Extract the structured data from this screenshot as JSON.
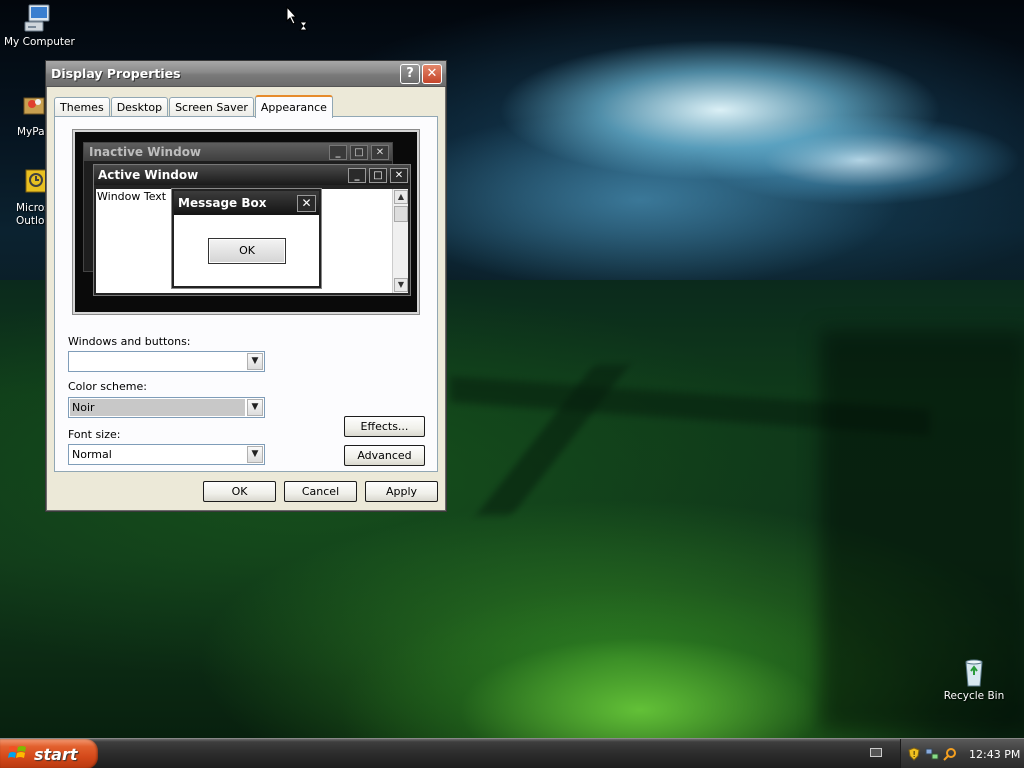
{
  "desktop": {
    "icons": [
      {
        "label": "My Computer"
      },
      {
        "label": "MyPa"
      },
      {
        "label": "Micros\nOutlo"
      },
      {
        "label": "Recycle Bin"
      }
    ]
  },
  "dialog": {
    "title": "Display Properties",
    "help_glyph": "?",
    "close_glyph": "✕",
    "tabs": [
      {
        "label": "Themes"
      },
      {
        "label": "Desktop"
      },
      {
        "label": "Screen Saver"
      },
      {
        "label": "Appearance",
        "active": true
      }
    ],
    "preview": {
      "inactive_title": "Inactive Window",
      "active_title": "Active Window",
      "window_text": "Window Text",
      "message_box_title": "Message Box",
      "message_ok": "OK"
    },
    "windows_buttons": {
      "label": "Windows and buttons:",
      "value": ""
    },
    "color_scheme": {
      "label": "Color scheme:",
      "value": "Noir"
    },
    "font_size": {
      "label": "Font size:",
      "value": "Normal"
    },
    "effects_label": "Effects...",
    "advanced_label": "Advanced",
    "ok_label": "OK",
    "cancel_label": "Cancel",
    "apply_label": "Apply"
  },
  "taskbar": {
    "start_label": "start",
    "clock": "12:43 PM"
  },
  "colors": {
    "titlebar": "#7a7a7a",
    "start_orange": "#d4491a",
    "dialog_face": "#ece9d8",
    "tab_accent": "#e68b2c"
  }
}
